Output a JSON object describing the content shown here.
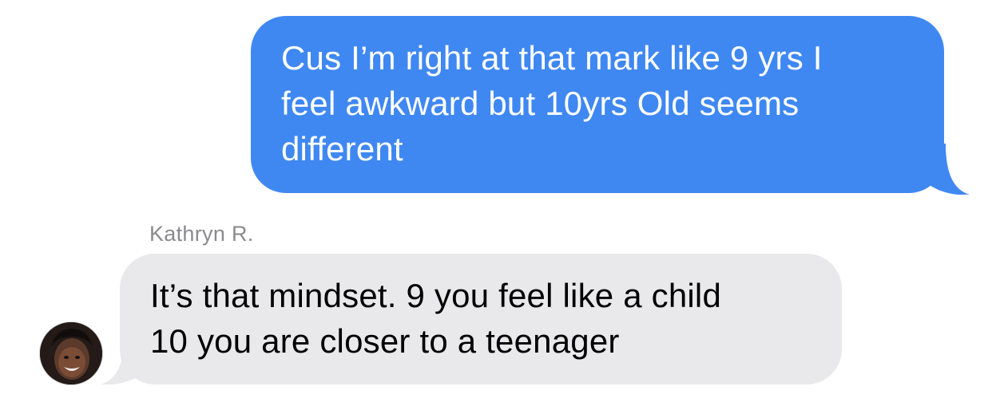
{
  "conversation": {
    "outgoing": {
      "lines": [
        "Cus I’m right at that mark like 9 yrs I",
        "feel awkward but 10yrs Old seems",
        "different"
      ]
    },
    "incoming": {
      "sender_name": "Kathryn R.",
      "lines": [
        "It’s that mindset. 9 you feel like a child",
        "10 you are closer to a teenager"
      ]
    }
  },
  "colors": {
    "outgoing_bubble": "#3f88f2",
    "incoming_bubble": "#e9e9eb",
    "sender_name_text": "#8a8a8f"
  }
}
